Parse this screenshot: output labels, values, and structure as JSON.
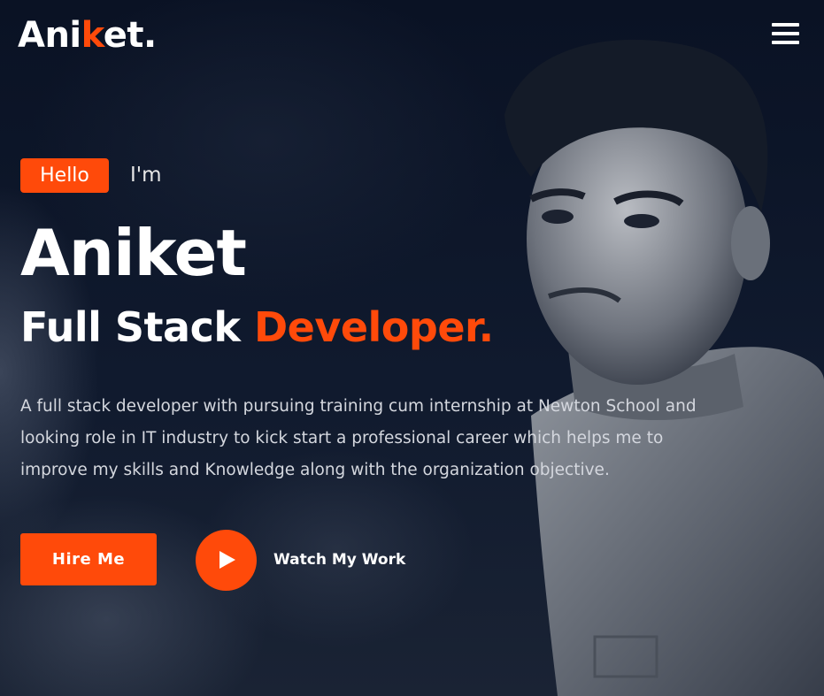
{
  "header": {
    "logo": {
      "prefix": "Ani",
      "accent": "k",
      "suffix": "et."
    },
    "menu_icon": "hamburger-menu-icon"
  },
  "hero": {
    "greeting_badge": "Hello",
    "greeting_text": "I'm",
    "name": "Aniket",
    "role_prefix": "Full Stack",
    "role_accent": "Developer.",
    "intro": "A full stack developer with pursuing training cum internship at Newton School and looking role in IT industry to kick start a professional career which helps me to improve my skills and Knowledge along with the organization objective.",
    "hire_button": "Hire Me",
    "watch_label": "Watch My Work",
    "play_icon": "play-icon",
    "portrait": "profile-photo"
  },
  "colors": {
    "accent": "#ff4a0a",
    "background": "#0d1526",
    "text": "#ffffff"
  }
}
